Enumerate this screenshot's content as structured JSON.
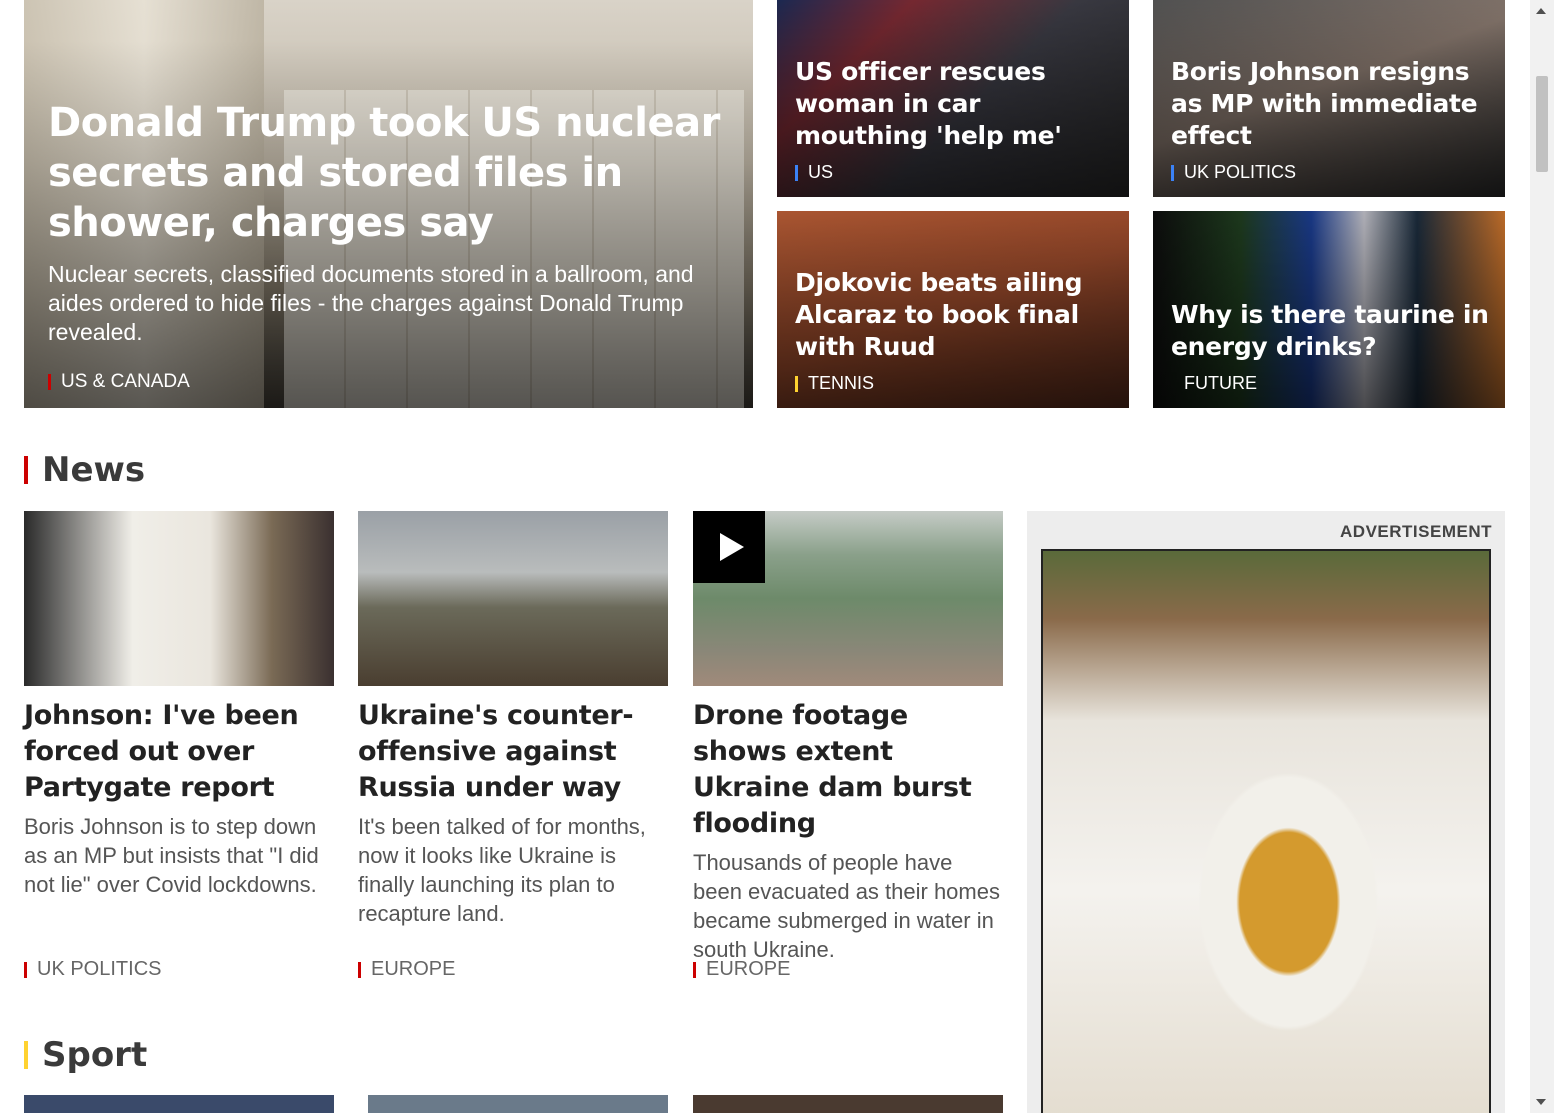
{
  "colors": {
    "news": "#cc0000",
    "sport": "#ffd230",
    "us_tag": "#3b82f6",
    "tennis_tag": "#ffd230"
  },
  "hero": {
    "headline": "Donald Trump took US nuclear secrets and stored files in shower, charges say",
    "summary": "Nuclear secrets, classified documents stored in a ballroom, and aides ordered to hide files - the charges against Donald Trump revealed.",
    "tag": "US & CANADA"
  },
  "tiles": [
    {
      "headline": "US officer rescues woman in car mouthing 'help me'",
      "tag": "US"
    },
    {
      "headline": "Boris Johnson resigns as MP with immediate effect",
      "tag": "UK POLITICS"
    },
    {
      "headline": "Djokovic beats ailing Alcaraz to book final with Ruud",
      "tag": "TENNIS"
    },
    {
      "headline": "Why is there taurine in energy drinks?",
      "tag": "FUTURE"
    }
  ],
  "sections": {
    "news": "News",
    "sport": "Sport"
  },
  "news_cards": [
    {
      "headline": "Johnson: I've been forced out over Partygate report",
      "summary": "Boris Johnson is to step down as an MP but insists that \"I did not lie\" over Covid lockdowns.",
      "tag": "UK POLITICS"
    },
    {
      "headline": "Ukraine's counter-offensive against Russia under way",
      "summary": "It's been talked of for months, now it looks like Ukraine is finally launching its plan to recapture land.",
      "tag": "EUROPE"
    },
    {
      "headline": "Drone footage shows extent Ukraine dam burst flooding",
      "summary": "Thousands of people have been evacuated as their homes became submerged in water in south Ukraine.",
      "tag": "EUROPE"
    }
  ],
  "advert": {
    "label": "ADVERTISEMENT"
  }
}
